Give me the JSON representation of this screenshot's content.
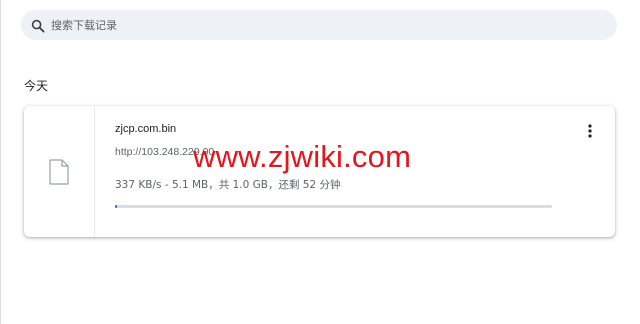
{
  "search": {
    "placeholder": "搜索下载记录",
    "icon": "search-icon"
  },
  "section": {
    "title": "今天"
  },
  "download": {
    "file_name": "zjcp.com.bin",
    "url": "http://103.248.229.90",
    "status": "337 KB/s - 5.1 MB，共 1.0 GB，还剩 52 分钟",
    "progress": 0.005,
    "file_icon": "file-icon",
    "more_icon": "more-vert-icon"
  },
  "watermark": {
    "text": "www.zjwiki.com",
    "color": "#e8141c"
  },
  "colors": {
    "accent": "#1a73e8",
    "search_bg": "#eef1f8",
    "secondary_text": "#5f6368"
  }
}
